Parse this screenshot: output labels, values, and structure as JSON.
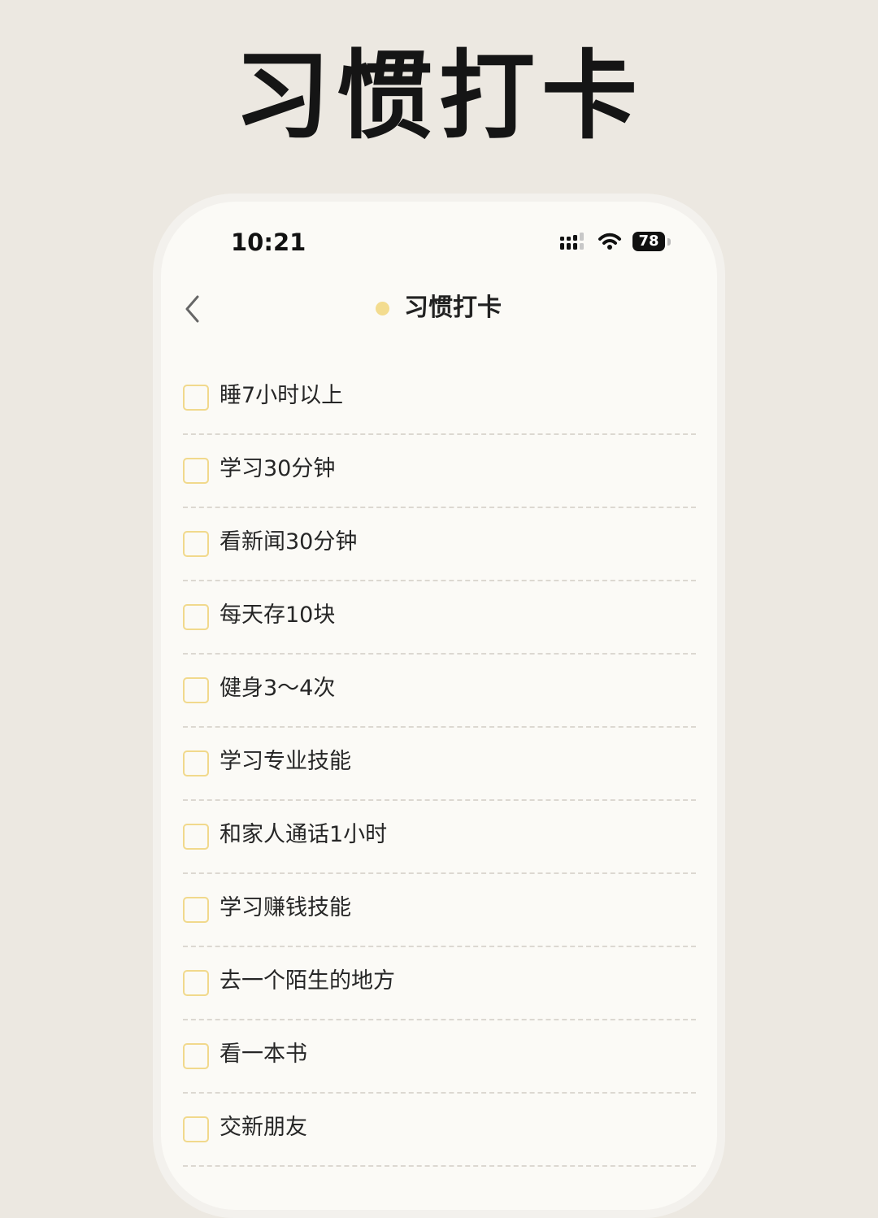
{
  "poster": {
    "title": "习惯打卡"
  },
  "status_bar": {
    "time": "10:21",
    "battery": "78",
    "signal_icon": "cellular-signal-icon",
    "wifi_icon": "wifi-icon",
    "battery_icon": "battery-icon"
  },
  "header": {
    "title": "习惯打卡",
    "back_icon": "chevron-left-icon",
    "dot_color": "#f3dc8f"
  },
  "colors": {
    "checkbox_border": "#f1d98c",
    "divider": "#dcd8d1",
    "background": "#ece8e1",
    "screen": "#fbfaf6"
  },
  "habits": [
    {
      "label": "睡7小时以上",
      "checked": false
    },
    {
      "label": "学习30分钟",
      "checked": false
    },
    {
      "label": "看新闻30分钟",
      "checked": false
    },
    {
      "label": "每天存10块",
      "checked": false
    },
    {
      "label": "健身3～4次",
      "checked": false
    },
    {
      "label": "学习专业技能",
      "checked": false
    },
    {
      "label": "和家人通话1小时",
      "checked": false
    },
    {
      "label": "学习赚钱技能",
      "checked": false
    },
    {
      "label": "去一个陌生的地方",
      "checked": false
    },
    {
      "label": "看一本书",
      "checked": false
    },
    {
      "label": "交新朋友",
      "checked": false
    }
  ]
}
